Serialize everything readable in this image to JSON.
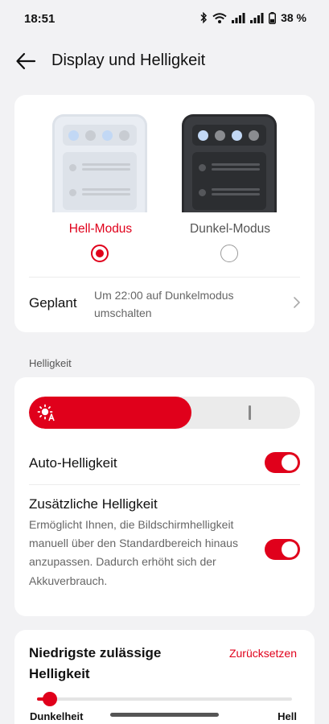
{
  "status_bar": {
    "time": "18:51",
    "battery": "38 %",
    "battery_level": 0.38,
    "icons": [
      "bluetooth-icon",
      "wifi-icon",
      "signal-icon",
      "signal-icon",
      "battery-icon"
    ]
  },
  "header": {
    "title": "Display und Helligkeit",
    "back_icon": "back-arrow-icon"
  },
  "theme": {
    "light_label": "Hell-Modus",
    "dark_label": "Dunkel-Modus",
    "selected": "light",
    "schedule_label": "Geplant",
    "schedule_value": "Um 22:00  auf Dunkelmodus umschalten",
    "preview_dot_colors_light": [
      "#c2d8f5",
      "#c8ccd2",
      "#c2d8f5",
      "#c8ccd2"
    ],
    "preview_dot_colors_dark": [
      "#c2d8f5",
      "#8a8c90",
      "#c2d8f5",
      "#8a8c90"
    ]
  },
  "brightness": {
    "section_label": "Helligkeit",
    "level": 0.6,
    "auto_label": "Auto-Helligkeit",
    "auto_on": true,
    "extra_label": "Zusätzliche Helligkeit",
    "extra_desc": "Ermöglicht Ihnen, die Bildschirmhelligkeit manuell über den Standardbereich hinaus anzupassen. Dadurch erhöht sich der Akkuverbrauch.",
    "extra_on": true
  },
  "min_brightness": {
    "title": "Niedrigste zulässige Helligkeit",
    "reset_label": "Zurücksetzen",
    "left_label": "Dunkelheit",
    "right_label": "Hell",
    "level": 0.05
  },
  "colors": {
    "accent": "#e0001b",
    "background": "#f2f2f4"
  }
}
